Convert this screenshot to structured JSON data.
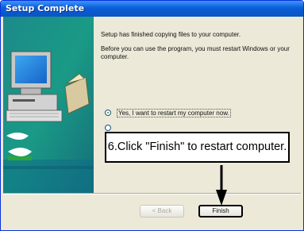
{
  "window": {
    "title": "Setup Complete"
  },
  "content": {
    "line1": "Setup has finished copying files to your computer.",
    "line2": "Before you can use the program, you must restart Windows or your computer.",
    "radio_yes_label": "Yes, I want to restart my computer now."
  },
  "buttons": {
    "back": "< Back",
    "finish": "Finish"
  },
  "callout": {
    "text": "6.Click \"Finish\" to restart computer."
  },
  "colors": {
    "titlebar": "#0a5ed7",
    "panel": "#ece9d8",
    "accent_green": "#2ea53a"
  }
}
